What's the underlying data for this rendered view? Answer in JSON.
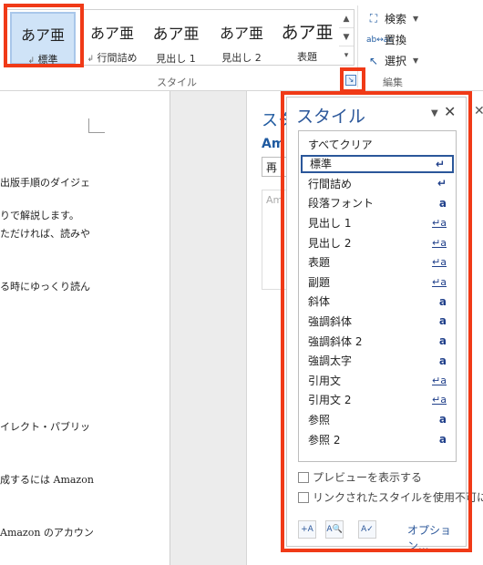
{
  "ribbon": {
    "gallery": [
      {
        "preview": "あア亜",
        "label": "標準",
        "selected": true,
        "prefix": "↲"
      },
      {
        "preview": "あア亜",
        "label": "行間詰め",
        "selected": false,
        "prefix": "↲"
      },
      {
        "preview": "あア亜",
        "label": "見出し 1",
        "selected": false,
        "prefix": ""
      },
      {
        "preview": "あア亜",
        "label": "見出し 2",
        "selected": false,
        "prefix": ""
      },
      {
        "preview": "あア亜",
        "label": "表題",
        "selected": false,
        "prefix": ""
      }
    ],
    "styles_group_label": "スタイル",
    "edit": {
      "find": "検索",
      "replace": "置換",
      "select": "選択",
      "group_label": "編集"
    }
  },
  "document": {
    "lines": [
      "出版手順のダイジェ",
      "りで解説します。",
      "ただければ、読みや",
      "る時にゆっくり読ん",
      "イレクト・パブリッ",
      "成するには Amazon",
      "Amazon のアカウン"
    ]
  },
  "back_pane": {
    "title": "スタ",
    "subtitle": "Am",
    "input": "再",
    "box_text": "Am"
  },
  "styles_pane": {
    "title": "スタイル",
    "items": [
      {
        "name": "すべてクリア",
        "mark": "",
        "underline": false
      },
      {
        "name": "標準",
        "mark": "↵",
        "underline": false
      },
      {
        "name": "行間詰め",
        "mark": "↵",
        "underline": false
      },
      {
        "name": "段落フォント",
        "mark": "a",
        "underline": false
      },
      {
        "name": "見出し 1",
        "mark": "↵a",
        "underline": true
      },
      {
        "name": "見出し 2",
        "mark": "↵a",
        "underline": true
      },
      {
        "name": "表題",
        "mark": "↵a",
        "underline": true
      },
      {
        "name": "副題",
        "mark": "↵a",
        "underline": true
      },
      {
        "name": "斜体",
        "mark": "a",
        "underline": false
      },
      {
        "name": "強調斜体",
        "mark": "a",
        "underline": false
      },
      {
        "name": "強調斜体 2",
        "mark": "a",
        "underline": false
      },
      {
        "name": "強調太字",
        "mark": "a",
        "underline": false
      },
      {
        "name": "引用文",
        "mark": "↵a",
        "underline": true
      },
      {
        "name": "引用文 2",
        "mark": "↵a",
        "underline": true
      },
      {
        "name": "参照",
        "mark": "a",
        "underline": false
      },
      {
        "name": "参照 2",
        "mark": "a",
        "underline": false
      }
    ],
    "show_preview": "プレビューを表示する",
    "disable_linked": "リンクされたスタイルを使用不可にす",
    "options_link": "オプション..."
  },
  "colors": {
    "highlight": "#f03a17",
    "accent": "#2b579a"
  }
}
